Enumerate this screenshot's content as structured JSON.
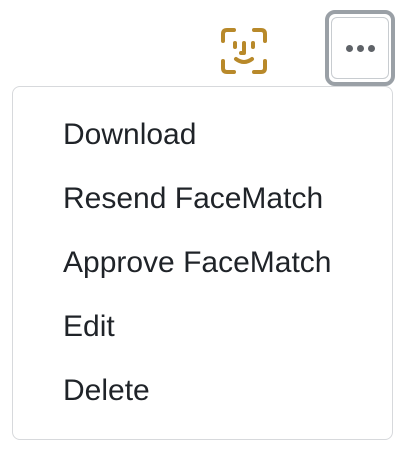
{
  "header": {
    "face_icon": "face-id-icon",
    "more_icon": "more-horizontal-icon",
    "accent_color": "#b8892a"
  },
  "menu": {
    "items": [
      {
        "label": "Download"
      },
      {
        "label": "Resend FaceMatch"
      },
      {
        "label": "Approve FaceMatch"
      },
      {
        "label": "Edit"
      },
      {
        "label": "Delete"
      }
    ]
  }
}
